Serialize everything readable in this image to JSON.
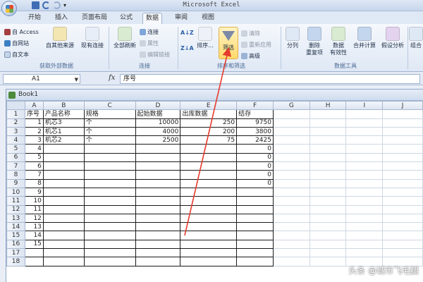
{
  "app": {
    "title": "Microsoft Excel"
  },
  "tabs": [
    "开始",
    "插入",
    "页面布局",
    "公式",
    "数据",
    "审阅",
    "视图"
  ],
  "active_tab": "数据",
  "ribbon": {
    "external_data": {
      "access": "自 Access",
      "web": "自网站",
      "text": "自文本",
      "other_sources": "自其他来源",
      "existing_connections": "现有连接",
      "group_label": "获取外部数据"
    },
    "connections": {
      "refresh_all": "全部刷新",
      "connections": "连接",
      "properties": "属性",
      "edit_links": "编辑链接",
      "group_label": "连接"
    },
    "sort_filter": {
      "sort_az": "A↓Z",
      "sort_za": "Z↓A",
      "sort": "排序...",
      "filter": "筛选",
      "clear": "清除",
      "reapply": "重新应用",
      "advanced": "高级",
      "group_label": "排序和筛选"
    },
    "data_tools": {
      "text_to_columns": "分列",
      "remove_duplicates": "删除\n重复项",
      "data_validation": "数据\n有效性",
      "consolidate": "合并计算",
      "what_if": "假设分析",
      "group_label": "数据工具"
    },
    "outline": {
      "group": "组合"
    }
  },
  "formula_bar": {
    "name_box": "A1",
    "fx": "fx",
    "value": "序号"
  },
  "workbook": {
    "title": "Book1"
  },
  "columns": [
    "A",
    "B",
    "C",
    "D",
    "E",
    "F",
    "G",
    "H",
    "I",
    "J"
  ],
  "rows": [
    {
      "r": "1",
      "cells": [
        "序号",
        "产品名称",
        "规格",
        "起始数据",
        "出库数据",
        "结存",
        "",
        "",
        "",
        ""
      ]
    },
    {
      "r": "2",
      "cells": [
        "1",
        "机芯3",
        "个",
        "10000",
        "250",
        "9750",
        "",
        "",
        "",
        ""
      ]
    },
    {
      "r": "3",
      "cells": [
        "2",
        "机芯1",
        "个",
        "4000",
        "200",
        "3800",
        "",
        "",
        "",
        ""
      ]
    },
    {
      "r": "4",
      "cells": [
        "3",
        "机芯2",
        "个",
        "2500",
        "75",
        "2425",
        "",
        "",
        "",
        ""
      ]
    },
    {
      "r": "5",
      "cells": [
        "4",
        "",
        "",
        "",
        "",
        "0",
        "",
        "",
        "",
        ""
      ]
    },
    {
      "r": "6",
      "cells": [
        "5",
        "",
        "",
        "",
        "",
        "0",
        "",
        "",
        "",
        ""
      ]
    },
    {
      "r": "7",
      "cells": [
        "6",
        "",
        "",
        "",
        "",
        "0",
        "",
        "",
        "",
        ""
      ]
    },
    {
      "r": "8",
      "cells": [
        "7",
        "",
        "",
        "",
        "",
        "0",
        "",
        "",
        "",
        ""
      ]
    },
    {
      "r": "9",
      "cells": [
        "8",
        "",
        "",
        "",
        "",
        "0",
        "",
        "",
        "",
        ""
      ]
    },
    {
      "r": "10",
      "cells": [
        "9",
        "",
        "",
        "",
        "",
        "",
        "",
        "",
        "",
        ""
      ]
    },
    {
      "r": "11",
      "cells": [
        "10",
        "",
        "",
        "",
        "",
        "",
        "",
        "",
        "",
        ""
      ]
    },
    {
      "r": "12",
      "cells": [
        "11",
        "",
        "",
        "",
        "",
        "",
        "",
        "",
        "",
        ""
      ]
    },
    {
      "r": "13",
      "cells": [
        "12",
        "",
        "",
        "",
        "",
        "",
        "",
        "",
        "",
        ""
      ]
    },
    {
      "r": "14",
      "cells": [
        "13",
        "",
        "",
        "",
        "",
        "",
        "",
        "",
        "",
        ""
      ]
    },
    {
      "r": "15",
      "cells": [
        "14",
        "",
        "",
        "",
        "",
        "",
        "",
        "",
        "",
        ""
      ]
    },
    {
      "r": "16",
      "cells": [
        "15",
        "",
        "",
        "",
        "",
        "",
        "",
        "",
        "",
        ""
      ]
    },
    {
      "r": "17",
      "cells": [
        "",
        "",
        "",
        "",
        "",
        "",
        "",
        "",
        "",
        ""
      ]
    },
    {
      "r": "18",
      "cells": [
        "",
        "",
        "",
        "",
        "",
        "",
        "",
        "",
        "",
        ""
      ]
    }
  ],
  "watermark": "头条 @城市飞毛腿",
  "colors": {
    "arrow": "#e53a2c",
    "accent": "#ffd96b"
  }
}
